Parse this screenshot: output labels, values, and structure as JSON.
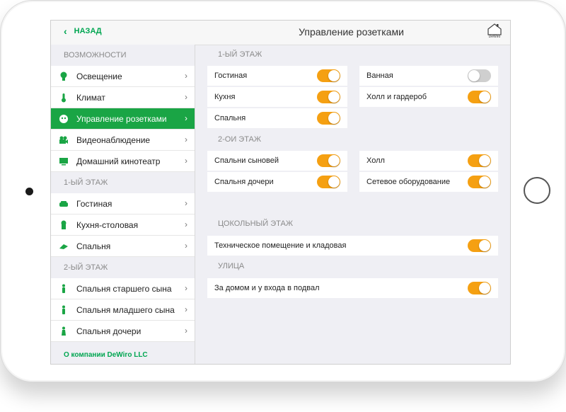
{
  "header": {
    "back_label": "НАЗАД",
    "title": "Управление розетками",
    "logo_text": "DeWiro"
  },
  "sidebar": {
    "sections": [
      {
        "title": "ВОЗМОЖНОСТИ",
        "items": [
          {
            "label": "Освещение",
            "icon": "lightbulb-icon"
          },
          {
            "label": "Климат",
            "icon": "thermometer-icon"
          },
          {
            "label": "Управление розетками",
            "icon": "socket-icon",
            "active": true
          },
          {
            "label": "Видеонаблюдение",
            "icon": "camera-icon"
          },
          {
            "label": "Домашний кинотеатр",
            "icon": "tv-icon"
          }
        ]
      },
      {
        "title": "1-ЫЙ ЭТАЖ",
        "items": [
          {
            "label": "Гостиная",
            "icon": "sofa-icon"
          },
          {
            "label": "Кухня-столовая",
            "icon": "chef-icon"
          },
          {
            "label": "Спальня",
            "icon": "bed-icon"
          }
        ]
      },
      {
        "title": "2-ЫЙ ЭТАЖ",
        "items": [
          {
            "label": "Спальня старшего сына",
            "icon": "person-icon"
          },
          {
            "label": "Спальня младшего сына",
            "icon": "person-icon"
          },
          {
            "label": "Спальня дочери",
            "icon": "person-icon"
          }
        ]
      }
    ],
    "about": "О компании DeWiro LLC"
  },
  "main": {
    "floor1": {
      "title": "1-ЫЙ ЭТАЖ",
      "left": [
        {
          "label": "Гостиная",
          "on": true
        },
        {
          "label": "Кухня",
          "on": true
        },
        {
          "label": "Спальня",
          "on": true
        }
      ],
      "right": [
        {
          "label": "Ванная",
          "on": false
        },
        {
          "label": "Холл и гардероб",
          "on": true
        }
      ]
    },
    "floor2": {
      "title": "2-ОИ ЭТАЖ",
      "left": [
        {
          "label": "Спальни сыновей",
          "on": true
        },
        {
          "label": "Спальня дочери",
          "on": true
        }
      ],
      "right": [
        {
          "label": "Холл",
          "on": true
        },
        {
          "label": "Сетевое оборудование",
          "on": true
        }
      ]
    },
    "basement": {
      "title": "ЦОКОЛЬНЫЙ ЭТАЖ",
      "item": {
        "label": "Техническое помещение и кладовая",
        "on": true
      }
    },
    "street": {
      "title": "УЛИЦА",
      "item": {
        "label": "За домом и у входа в подвал",
        "on": true
      }
    }
  },
  "colors": {
    "accent": "#1aa545",
    "toggle_on": "#f5a012",
    "toggle_off": "#cfcfcf"
  }
}
